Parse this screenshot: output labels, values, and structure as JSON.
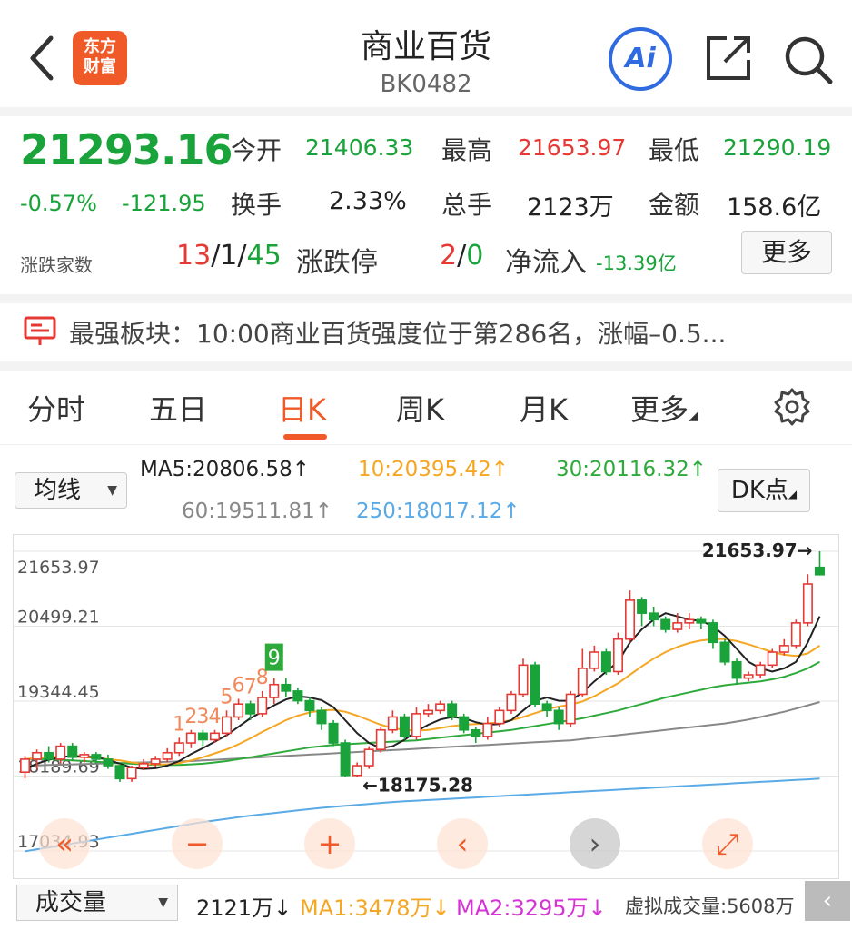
{
  "header": {
    "title": "商业百货",
    "code": "BK0482",
    "logo_line1": "东方",
    "logo_line2": "财富",
    "ai_label": "Ai"
  },
  "quote": {
    "price": "21293.16",
    "change_pct": "-0.57%",
    "change": "-121.95",
    "open_label": "今开",
    "open": "21406.33",
    "high_label": "最高",
    "high": "21653.97",
    "low_label": "最低",
    "low": "21290.19",
    "turnover_label": "换手",
    "turnover": "2.33%",
    "volume_label": "总手",
    "volume": "2123万",
    "amount_label": "金额",
    "amount": "158.6亿",
    "breadth_label": "涨跌家数",
    "breadth_up": "13",
    "sep1": "/",
    "breadth_flat": "1",
    "sep2": "/",
    "breadth_down": "45",
    "limit_label": "涨跌停",
    "limit_up": "2",
    "sep3": "/",
    "limit_down": "0",
    "netflow_label": "净流入",
    "netflow": "-13.39亿",
    "more_label": "更多"
  },
  "news": {
    "text": "最强板块：10:00商业百货强度位于第286名，涨幅–0.5..."
  },
  "tabs": [
    {
      "label": "分时"
    },
    {
      "label": "五日"
    },
    {
      "label": "日K"
    },
    {
      "label": "周K"
    },
    {
      "label": "月K"
    },
    {
      "label": "更多"
    }
  ],
  "ma": {
    "dropdown_label": "均线",
    "ma5": "MA5:20806.58↑",
    "ma10": "10:20395.42↑",
    "ma30": "30:20116.32↑",
    "ma60": "60:19511.81↑",
    "ma250": "250:18017.12↑",
    "dk_label": "DK点"
  },
  "colors": {
    "up": "#e53935",
    "down": "#1aa33a",
    "ma5": "#222222",
    "ma10": "#f5a623",
    "ma30": "#2eaa3c",
    "ma60": "#888888",
    "ma250": "#5aaae6",
    "accent": "#f05a28"
  },
  "chart_data": {
    "type": "candlestick",
    "y_ticks": [
      "21653.97",
      "20499.21",
      "19344.45",
      "18189.69",
      "17034.93"
    ],
    "ylim": [
      17034.93,
      21653.97
    ],
    "high_annotation": "21653.97→",
    "low_annotation": "←18175.28",
    "signal_labels": [
      "1",
      "2",
      "3",
      "4",
      "5",
      "6",
      "7",
      "8",
      "9"
    ],
    "candles": [
      {
        "o": 18250,
        "c": 18450,
        "h": 18500,
        "l": 18150
      },
      {
        "o": 18450,
        "c": 18550,
        "h": 18600,
        "l": 18300
      },
      {
        "o": 18550,
        "c": 18450,
        "h": 18650,
        "l": 18400
      },
      {
        "o": 18450,
        "c": 18650,
        "h": 18700,
        "l": 18380
      },
      {
        "o": 18650,
        "c": 18480,
        "h": 18700,
        "l": 18420
      },
      {
        "o": 18480,
        "c": 18520,
        "h": 18560,
        "l": 18400
      },
      {
        "o": 18520,
        "c": 18450,
        "h": 18560,
        "l": 18380
      },
      {
        "o": 18450,
        "c": 18350,
        "h": 18520,
        "l": 18300
      },
      {
        "o": 18350,
        "c": 18150,
        "h": 18380,
        "l": 18100
      },
      {
        "o": 18150,
        "c": 18320,
        "h": 18350,
        "l": 18100
      },
      {
        "o": 18320,
        "c": 18380,
        "h": 18450,
        "l": 18280
      },
      {
        "o": 18380,
        "c": 18450,
        "h": 18500,
        "l": 18330
      },
      {
        "o": 18450,
        "c": 18550,
        "h": 18620,
        "l": 18400
      },
      {
        "o": 18550,
        "c": 18700,
        "h": 18780,
        "l": 18500
      },
      {
        "o": 18700,
        "c": 18850,
        "h": 18900,
        "l": 18620
      },
      {
        "o": 18850,
        "c": 18750,
        "h": 18900,
        "l": 18650
      },
      {
        "o": 18750,
        "c": 18850,
        "h": 18900,
        "l": 18700
      },
      {
        "o": 18850,
        "c": 19100,
        "h": 19200,
        "l": 18800
      },
      {
        "o": 19100,
        "c": 19300,
        "h": 19380,
        "l": 19050
      },
      {
        "o": 19300,
        "c": 19150,
        "h": 19350,
        "l": 19050
      },
      {
        "o": 19150,
        "c": 19400,
        "h": 19500,
        "l": 19100
      },
      {
        "o": 19400,
        "c": 19600,
        "h": 19700,
        "l": 19300
      },
      {
        "o": 19600,
        "c": 19500,
        "h": 19700,
        "l": 19400
      },
      {
        "o": 19500,
        "c": 19350,
        "h": 19550,
        "l": 19300
      },
      {
        "o": 19350,
        "c": 19200,
        "h": 19400,
        "l": 19100
      },
      {
        "o": 19200,
        "c": 19000,
        "h": 19250,
        "l": 18900
      },
      {
        "o": 19000,
        "c": 18700,
        "h": 19050,
        "l": 18650
      },
      {
        "o": 18700,
        "c": 18200,
        "h": 18750,
        "l": 18175.28
      },
      {
        "o": 18200,
        "c": 18350,
        "h": 18400,
        "l": 18175.28
      },
      {
        "o": 18350,
        "c": 18600,
        "h": 18650,
        "l": 18300
      },
      {
        "o": 18600,
        "c": 18900,
        "h": 18950,
        "l": 18550
      },
      {
        "o": 18900,
        "c": 19100,
        "h": 19200,
        "l": 18850
      },
      {
        "o": 19100,
        "c": 18800,
        "h": 19150,
        "l": 18750
      },
      {
        "o": 18800,
        "c": 19150,
        "h": 19250,
        "l": 18750
      },
      {
        "o": 19150,
        "c": 19200,
        "h": 19300,
        "l": 19100
      },
      {
        "o": 19200,
        "c": 19300,
        "h": 19350,
        "l": 19150
      },
      {
        "o": 19300,
        "c": 19100,
        "h": 19350,
        "l": 19050
      },
      {
        "o": 19100,
        "c": 18900,
        "h": 19150,
        "l": 18850
      },
      {
        "o": 18900,
        "c": 18800,
        "h": 18950,
        "l": 18700
      },
      {
        "o": 18800,
        "c": 19000,
        "h": 19100,
        "l": 18750
      },
      {
        "o": 19000,
        "c": 19200,
        "h": 19250,
        "l": 18950
      },
      {
        "o": 19200,
        "c": 19450,
        "h": 19500,
        "l": 19150
      },
      {
        "o": 19450,
        "c": 19900,
        "h": 20000,
        "l": 19400
      },
      {
        "o": 19900,
        "c": 19300,
        "h": 19950,
        "l": 19250
      },
      {
        "o": 19300,
        "c": 19200,
        "h": 19350,
        "l": 19100
      },
      {
        "o": 19200,
        "c": 19000,
        "h": 19250,
        "l": 18900
      },
      {
        "o": 19000,
        "c": 19450,
        "h": 19500,
        "l": 18950
      },
      {
        "o": 19450,
        "c": 19850,
        "h": 20150,
        "l": 19400
      },
      {
        "o": 19850,
        "c": 20100,
        "h": 20200,
        "l": 19800
      },
      {
        "o": 20100,
        "c": 19800,
        "h": 20150,
        "l": 19750
      },
      {
        "o": 19800,
        "c": 20300,
        "h": 20400,
        "l": 19750
      },
      {
        "o": 20300,
        "c": 20900,
        "h": 21050,
        "l": 20250
      },
      {
        "o": 20900,
        "c": 20700,
        "h": 20950,
        "l": 20500
      },
      {
        "o": 20700,
        "c": 20600,
        "h": 20800,
        "l": 20500
      },
      {
        "o": 20600,
        "c": 20450,
        "h": 20650,
        "l": 20400
      },
      {
        "o": 20450,
        "c": 20550,
        "h": 20700,
        "l": 20400
      },
      {
        "o": 20550,
        "c": 20600,
        "h": 20700,
        "l": 20450
      },
      {
        "o": 20600,
        "c": 20550,
        "h": 20650,
        "l": 20450
      },
      {
        "o": 20550,
        "c": 20250,
        "h": 20600,
        "l": 20150
      },
      {
        "o": 20250,
        "c": 19950,
        "h": 20300,
        "l": 19900
      },
      {
        "o": 19950,
        "c": 19700,
        "h": 20000,
        "l": 19600
      },
      {
        "o": 19700,
        "c": 19750,
        "h": 19800,
        "l": 19650
      },
      {
        "o": 19750,
        "c": 19900,
        "h": 19950,
        "l": 19700
      },
      {
        "o": 19900,
        "c": 20100,
        "h": 20150,
        "l": 19850
      },
      {
        "o": 20100,
        "c": 20200,
        "h": 20300,
        "l": 20050
      },
      {
        "o": 20200,
        "c": 20550,
        "h": 20600,
        "l": 20150
      },
      {
        "o": 20550,
        "c": 21150,
        "h": 21300,
        "l": 20500
      },
      {
        "o": 21406.33,
        "c": 21293.16,
        "h": 21653.97,
        "l": 21290.19
      }
    ],
    "ma5": [
      18300,
      18380,
      18440,
      18480,
      18500,
      18490,
      18480,
      18440,
      18380,
      18320,
      18300,
      18310,
      18350,
      18420,
      18530,
      18620,
      18720,
      18820,
      18950,
      19080,
      19180,
      19280,
      19370,
      19420,
      19400,
      19360,
      19250,
      19050,
      18850,
      18700,
      18620,
      18650,
      18750,
      18880,
      18980,
      19060,
      19100,
      19080,
      19020,
      18980,
      18990,
      19050,
      19200,
      19350,
      19400,
      19350,
      19350,
      19480,
      19650,
      19800,
      19950,
      20250,
      20450,
      20600,
      20700,
      20650,
      20600,
      20580,
      20500,
      20350,
      20150,
      19950,
      19850,
      19800,
      19850,
      19950,
      20250,
      20650
    ],
    "ma10": [
      18450,
      18470,
      18480,
      18490,
      18490,
      18480,
      18470,
      18450,
      18430,
      18400,
      18380,
      18370,
      18370,
      18390,
      18430,
      18480,
      18540,
      18600,
      18680,
      18770,
      18870,
      18960,
      19050,
      19120,
      19170,
      19200,
      19210,
      19180,
      19120,
      19050,
      18980,
      18930,
      18900,
      18890,
      18900,
      18930,
      18960,
      18980,
      18990,
      19000,
      19020,
      19050,
      19100,
      19160,
      19220,
      19260,
      19290,
      19340,
      19420,
      19520,
      19620,
      19750,
      19880,
      20000,
      20100,
      20180,
      20240,
      20280,
      20300,
      20300,
      20270,
      20220,
      20160,
      20100,
      20060,
      20040,
      20080,
      20200
    ],
    "ma30": [
      18450,
      18450,
      18450,
      18440,
      18430,
      18420,
      18410,
      18400,
      18390,
      18380,
      18370,
      18360,
      18360,
      18360,
      18370,
      18380,
      18400,
      18420,
      18450,
      18480,
      18510,
      18540,
      18570,
      18600,
      18630,
      18650,
      18670,
      18680,
      18690,
      18700,
      18710,
      18720,
      18730,
      18740,
      18760,
      18780,
      18800,
      18820,
      18840,
      18860,
      18880,
      18900,
      18930,
      18960,
      18990,
      19020,
      19050,
      19080,
      19120,
      19160,
      19200,
      19250,
      19300,
      19350,
      19400,
      19440,
      19480,
      19520,
      19560,
      19590,
      19610,
      19630,
      19650,
      19680,
      19720,
      19780,
      19850,
      19950
    ],
    "ma60": [
      18350,
      18355,
      18360,
      18365,
      18370,
      18375,
      18380,
      18385,
      18390,
      18395,
      18400,
      18405,
      18410,
      18415,
      18420,
      18430,
      18440,
      18450,
      18460,
      18470,
      18480,
      18490,
      18500,
      18510,
      18520,
      18530,
      18540,
      18550,
      18560,
      18570,
      18580,
      18590,
      18600,
      18610,
      18620,
      18630,
      18640,
      18650,
      18660,
      18670,
      18680,
      18690,
      18700,
      18710,
      18720,
      18730,
      18740,
      18760,
      18780,
      18800,
      18820,
      18840,
      18860,
      18880,
      18900,
      18920,
      18940,
      18960,
      18980,
      19000,
      19030,
      19060,
      19100,
      19140,
      19180,
      19230,
      19280,
      19330
    ],
    "ma250": [
      17030,
      17060,
      17090,
      17120,
      17150,
      17180,
      17210,
      17240,
      17270,
      17300,
      17330,
      17360,
      17390,
      17420,
      17450,
      17480,
      17505,
      17530,
      17555,
      17580,
      17600,
      17620,
      17640,
      17660,
      17680,
      17700,
      17715,
      17730,
      17745,
      17760,
      17775,
      17790,
      17800,
      17810,
      17820,
      17830,
      17840,
      17850,
      17860,
      17870,
      17880,
      17890,
      17900,
      17910,
      17920,
      17930,
      17940,
      17950,
      17960,
      17970,
      17980,
      17990,
      18000,
      18010,
      18020,
      18030,
      18040,
      18050,
      18060,
      18070,
      18080,
      18090,
      18100,
      18110,
      18120,
      18130,
      18140,
      18150
    ]
  },
  "chart_controls": {
    "rewind_icon": "«",
    "zoom_out_icon": "−",
    "zoom_in_icon": "+",
    "prev_icon": "‹",
    "next_icon": "›",
    "expand_icon": "⤢"
  },
  "volume": {
    "dropdown_label": "成交量",
    "vol": "2121万↓",
    "ma1": "MA1:3478万↓",
    "ma2": "MA2:3295万↓",
    "virtual": "虚拟成交量:5608万",
    "scroll_icon": "‹"
  }
}
